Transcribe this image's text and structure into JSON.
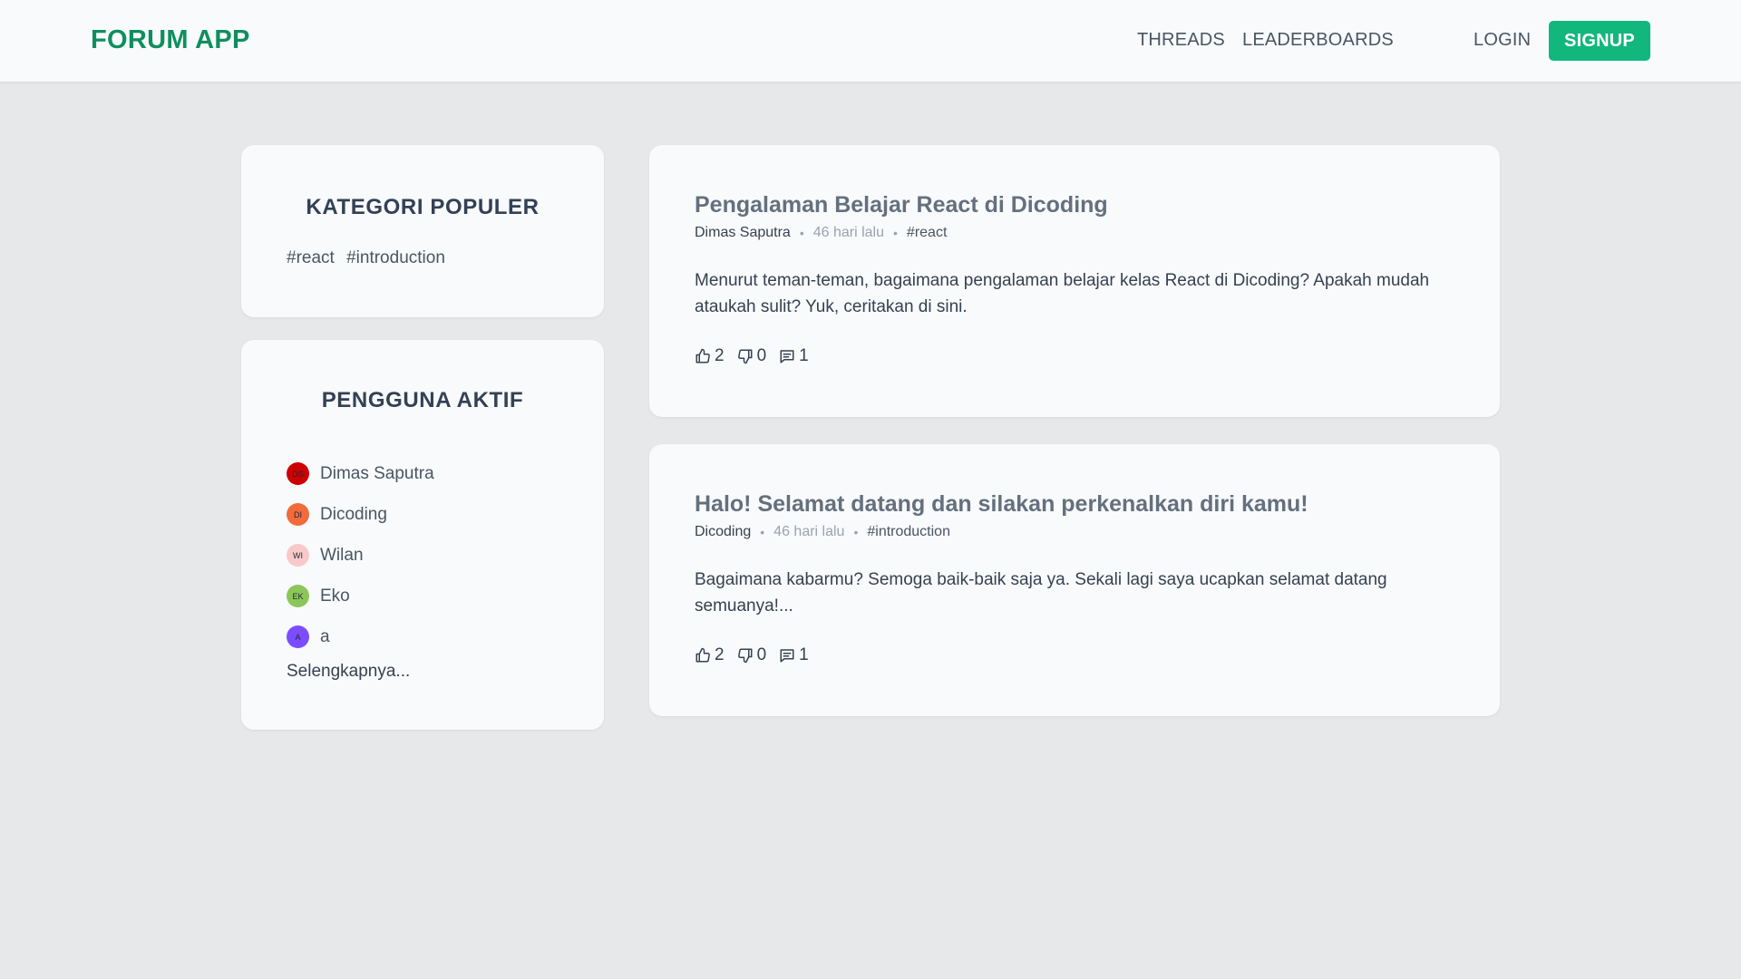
{
  "header": {
    "brand": "FORUM APP",
    "nav": {
      "threads": "THREADS",
      "leaderboards": "LEADERBOARDS"
    },
    "login": "LOGIN",
    "signup": "SIGNUP"
  },
  "sidebar": {
    "categories": {
      "title": "KATEGORI POPULER",
      "tags": [
        "#react",
        "#introduction"
      ]
    },
    "users": {
      "title": "PENGGUNA AKTIF",
      "items": [
        {
          "initials": "DS",
          "name": "Dimas Saputra",
          "color": "#cc0000"
        },
        {
          "initials": "DI",
          "name": "Dicoding",
          "color": "#f26b3a"
        },
        {
          "initials": "WI",
          "name": "Wilan",
          "color": "#f9c9c9"
        },
        {
          "initials": "EK",
          "name": "Eko",
          "color": "#8cc65a"
        },
        {
          "initials": "A",
          "name": "a",
          "color": "#7c4dff"
        }
      ],
      "more": "Selengkapnya..."
    }
  },
  "threads": [
    {
      "title": "Pengalaman Belajar React di Dicoding",
      "author": "Dimas Saputra",
      "time": "46 hari lalu",
      "category": "#react",
      "body": "Menurut teman-teman, bagaimana pengalaman belajar kelas React di Dicoding? Apakah mudah ataukah sulit? Yuk, ceritakan di sini.",
      "upvotes": "2",
      "downvotes": "0",
      "comments": "1"
    },
    {
      "title": "Halo! Selamat datang dan silakan perkenalkan diri kamu!",
      "author": "Dicoding",
      "time": "46 hari lalu",
      "category": "#introduction",
      "body": "Bagaimana kabarmu? Semoga baik-baik saja ya. Sekali lagi saya ucapkan selamat datang semuanya!...",
      "upvotes": "2",
      "downvotes": "0",
      "comments": "1"
    }
  ],
  "icons": {
    "upvote": "thumbs-up-icon",
    "downvote": "thumbs-down-icon",
    "comment": "comment-icon"
  },
  "colors": {
    "brand": "#0f8f5e",
    "signup": "#11b77d",
    "background": "#e7e8ea",
    "card": "#f8fafc"
  }
}
